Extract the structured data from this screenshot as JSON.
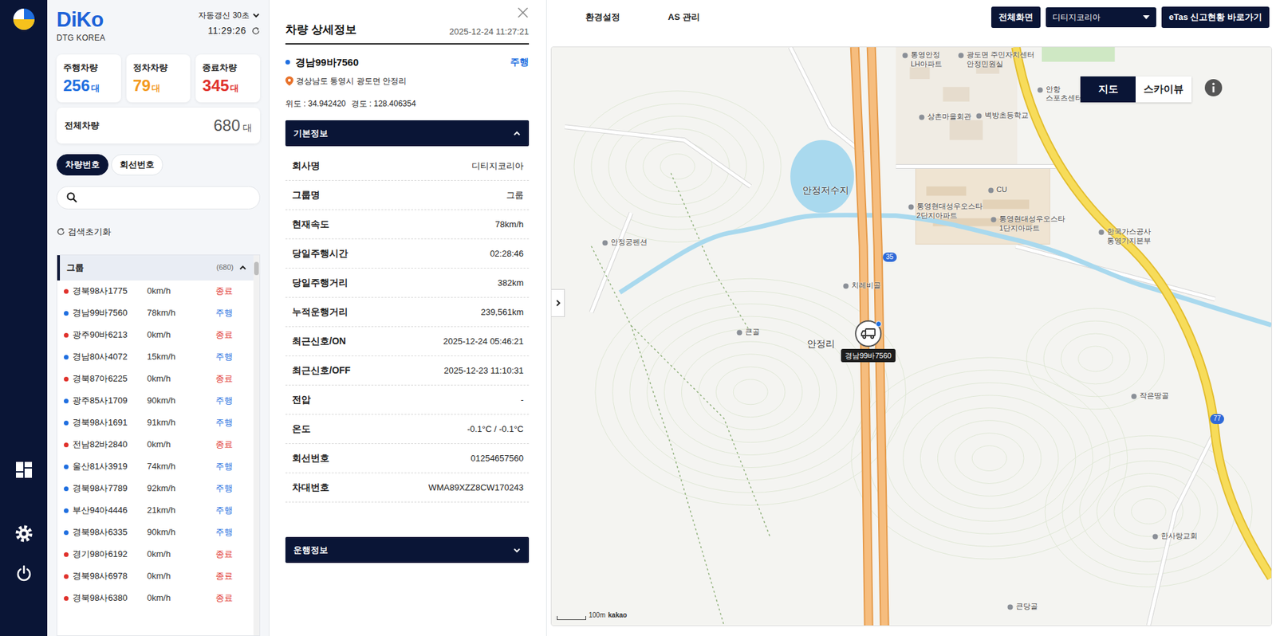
{
  "logo": {
    "name": "DiKo",
    "subtitle": "DTG KOREA"
  },
  "refresh": {
    "interval": "자동갱신 30초",
    "time": "11:29:26"
  },
  "stats": [
    {
      "label": "주행차량",
      "value": "256",
      "unit": "대",
      "color": "#1f6fe0"
    },
    {
      "label": "정차차량",
      "value": "79",
      "unit": "대",
      "color": "#f39a1e"
    },
    {
      "label": "종료차량",
      "value": "345",
      "unit": "대",
      "color": "#e0312b"
    }
  ],
  "total": {
    "label": "전체차량",
    "value": "680",
    "unit": "대"
  },
  "search_tabs": [
    {
      "label": "차량번호",
      "selected": true
    },
    {
      "label": "회선번호",
      "selected": false
    }
  ],
  "search": {
    "placeholder": ""
  },
  "reset": {
    "label": "검색초기화"
  },
  "group": {
    "label": "그룹",
    "count": "(680)",
    "expanded": true
  },
  "vehicles": [
    {
      "plate": "경북98사1775",
      "speed": "0km/h",
      "status": "종료",
      "color": "#e0312b"
    },
    {
      "plate": "경남99바7560",
      "speed": "78km/h",
      "status": "주행",
      "color": "#1f6fe0"
    },
    {
      "plate": "광주90바6213",
      "speed": "0km/h",
      "status": "종료",
      "color": "#e0312b"
    },
    {
      "plate": "경남80사4072",
      "speed": "15km/h",
      "status": "주행",
      "color": "#1f6fe0"
    },
    {
      "plate": "경북87아6225",
      "speed": "0km/h",
      "status": "종료",
      "color": "#e0312b"
    },
    {
      "plate": "광주85사1709",
      "speed": "90km/h",
      "status": "주행",
      "color": "#1f6fe0"
    },
    {
      "plate": "경북98사1691",
      "speed": "91km/h",
      "status": "주행",
      "color": "#1f6fe0"
    },
    {
      "plate": "전남82바2840",
      "speed": "0km/h",
      "status": "종료",
      "color": "#e0312b"
    },
    {
      "plate": "울산81사3919",
      "speed": "74km/h",
      "status": "주행",
      "color": "#1f6fe0"
    },
    {
      "plate": "경북98사7789",
      "speed": "92km/h",
      "status": "주행",
      "color": "#1f6fe0"
    },
    {
      "plate": "부산94아4446",
      "speed": "21km/h",
      "status": "주행",
      "color": "#1f6fe0"
    },
    {
      "plate": "경북98사6335",
      "speed": "90km/h",
      "status": "주행",
      "color": "#1f6fe0"
    },
    {
      "plate": "경기98아6192",
      "speed": "0km/h",
      "status": "종료",
      "color": "#e0312b"
    },
    {
      "plate": "경북98사6978",
      "speed": "0km/h",
      "status": "종료",
      "color": "#e0312b"
    },
    {
      "plate": "경북98사6380",
      "speed": "0km/h",
      "status": "종료",
      "color": "#e0312b"
    }
  ],
  "detail": {
    "title": "차량 상세정보",
    "time": "2025-12-24 11:27:21",
    "plate": "경남99바7560",
    "status": "주행",
    "address": "경상남도 통영시 광도면 안정리",
    "lat": "위도 : 34.942420",
    "lng": "경도 : 128.406354",
    "sections": [
      {
        "title": "기본정보",
        "expanded": true,
        "rows": [
          {
            "label": "회사명",
            "value": "디티지코리아"
          },
          {
            "label": "그룹명",
            "value": "그룹"
          },
          {
            "label": "현재속도",
            "value": "78km/h"
          },
          {
            "label": "당일주행시간",
            "value": "02:28:46"
          },
          {
            "label": "당일주행거리",
            "value": "382km"
          },
          {
            "label": "누적운행거리",
            "value": "239,561km"
          },
          {
            "label": "최근신호/ON",
            "value": "2025-12-24 05:46:21"
          },
          {
            "label": "최근신호/OFF",
            "value": "2025-12-23 11:10:31"
          },
          {
            "label": "전압",
            "value": "-"
          },
          {
            "label": "온도",
            "value": "-0.1°C / -0.1°C"
          },
          {
            "label": "회선번호",
            "value": "01254657560"
          },
          {
            "label": "차대번호",
            "value": "WMA89XZZ8CW170243"
          }
        ]
      },
      {
        "title": "운행정보",
        "expanded": false,
        "rows": []
      }
    ]
  },
  "topbar": {
    "menus": [
      "환경설정",
      "AS 관리"
    ],
    "fullscreen": "전체화면",
    "company": "디티지코리아",
    "etas": "eTas 신고현황 바로가기"
  },
  "map": {
    "views": [
      {
        "label": "지도",
        "selected": true
      },
      {
        "label": "스카이뷰",
        "selected": false
      }
    ],
    "marker": "경남99바7560",
    "labels": [
      {
        "text": "통영안정\nLH아파트",
        "kind": "poi"
      },
      {
        "text": "광도면 주민자치센터\n안정민원실",
        "kind": "poi"
      },
      {
        "text": "안항\n스포츠센터",
        "kind": "poi"
      },
      {
        "text": "상촌마을회관",
        "kind": "poi"
      },
      {
        "text": "벽방초등학교",
        "kind": "poi"
      },
      {
        "text": "안정저수지",
        "kind": "area"
      },
      {
        "text": "CU",
        "kind": "poi"
      },
      {
        "text": "통영현대성우오스타\n2단지아파트",
        "kind": "poi"
      },
      {
        "text": "통영현대성우오스타\n1단지아파트",
        "kind": "poi"
      },
      {
        "text": "한국가스공사\n통영기지본부",
        "kind": "poi"
      },
      {
        "text": "안정궁펜션",
        "kind": "poi"
      },
      {
        "text": "치레비골",
        "kind": "poi"
      },
      {
        "text": "큰골",
        "kind": "poi"
      },
      {
        "text": "안정리",
        "kind": "area"
      },
      {
        "text": "작은땅골",
        "kind": "poi"
      },
      {
        "text": "한사랑교회",
        "kind": "poi"
      },
      {
        "text": "큰당골",
        "kind": "poi"
      },
      {
        "text": "35",
        "kind": "badge"
      },
      {
        "text": "77",
        "kind": "badge"
      }
    ],
    "scale": "100m",
    "brand": "kakao"
  }
}
